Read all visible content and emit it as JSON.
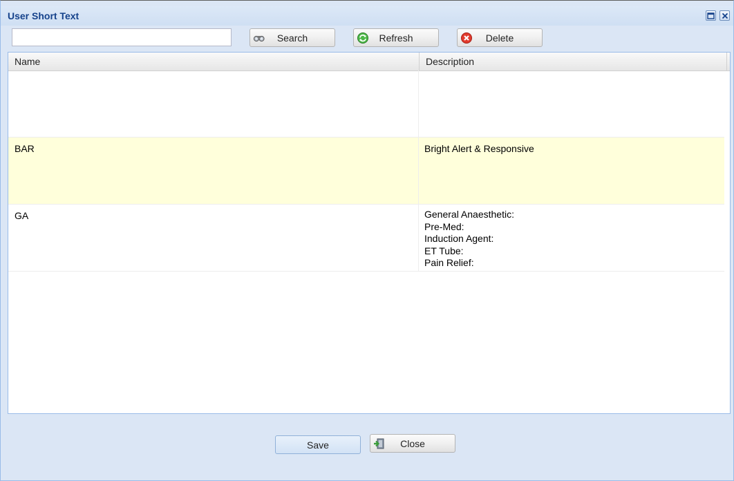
{
  "window": {
    "title": "User Short Text",
    "maximize_icon": "maximize-icon",
    "close_icon": "close-icon"
  },
  "toolbar": {
    "search_value": "",
    "search_placeholder": "",
    "search_label": "Search",
    "search_icon": "binoculars-icon",
    "refresh_label": "Refresh",
    "refresh_icon": "refresh-icon",
    "delete_label": "Delete",
    "delete_icon": "delete-icon"
  },
  "grid": {
    "columns": [
      "Name",
      "Description"
    ],
    "rows": [
      {
        "name": "",
        "description": ""
      },
      {
        "name": "BAR",
        "description": "Bright Alert & Responsive",
        "selected": true
      },
      {
        "name": "GA",
        "description": "General Anaesthetic:\nPre-Med:\nInduction Agent:\nET Tube:\nPain Relief:"
      }
    ]
  },
  "footer": {
    "save_label": "Save",
    "close_label": "Close",
    "close_icon": "exit-door-icon"
  },
  "colors": {
    "title": "#15428b",
    "window_bg": "#dbe6f5",
    "border": "#99bbe8",
    "selected_row": "#ffffdb",
    "delete_icon": "#e23b2e",
    "refresh_icon": "#4cb848"
  }
}
